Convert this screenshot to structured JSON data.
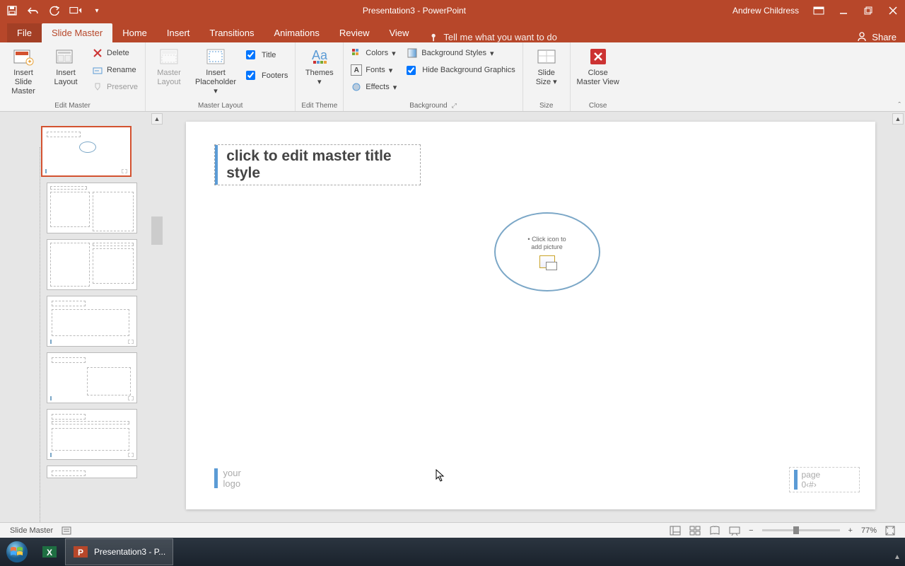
{
  "titlebar": {
    "title": "Presentation3 - PowerPoint",
    "user": "Andrew Childress"
  },
  "tabs": {
    "file": "File",
    "slidemaster": "Slide Master",
    "home": "Home",
    "insert": "Insert",
    "transitions": "Transitions",
    "animations": "Animations",
    "review": "Review",
    "view": "View",
    "tellme": "Tell me what you want to do",
    "share": "Share"
  },
  "ribbon": {
    "insert_slide_master": "Insert Slide\nMaster",
    "insert_layout": "Insert\nLayout",
    "delete": "Delete",
    "rename": "Rename",
    "preserve": "Preserve",
    "group_edit_master": "Edit Master",
    "master_layout": "Master\nLayout",
    "insert_placeholder": "Insert\nPlaceholder",
    "title": "Title",
    "footers": "Footers",
    "group_master_layout": "Master Layout",
    "themes": "Themes",
    "group_edit_theme": "Edit Theme",
    "colors": "Colors",
    "fonts": "Fonts",
    "effects": "Effects",
    "background_styles": "Background Styles",
    "hide_bg_graphics": "Hide Background Graphics",
    "group_background": "Background",
    "slide_size": "Slide\nSize",
    "group_size": "Size",
    "close_master_view": "Close\nMaster View",
    "group_close": "Close"
  },
  "slide": {
    "title_placeholder": "click to edit master title style",
    "oval_text": "Click icon to\nadd picture",
    "footer_left": "your\nlogo",
    "footer_right_label": "page",
    "footer_right_num": "0‹#›"
  },
  "status": {
    "view_label": "Slide Master",
    "zoom": "77%"
  },
  "taskbar": {
    "pp": "Presentation3 - P..."
  }
}
